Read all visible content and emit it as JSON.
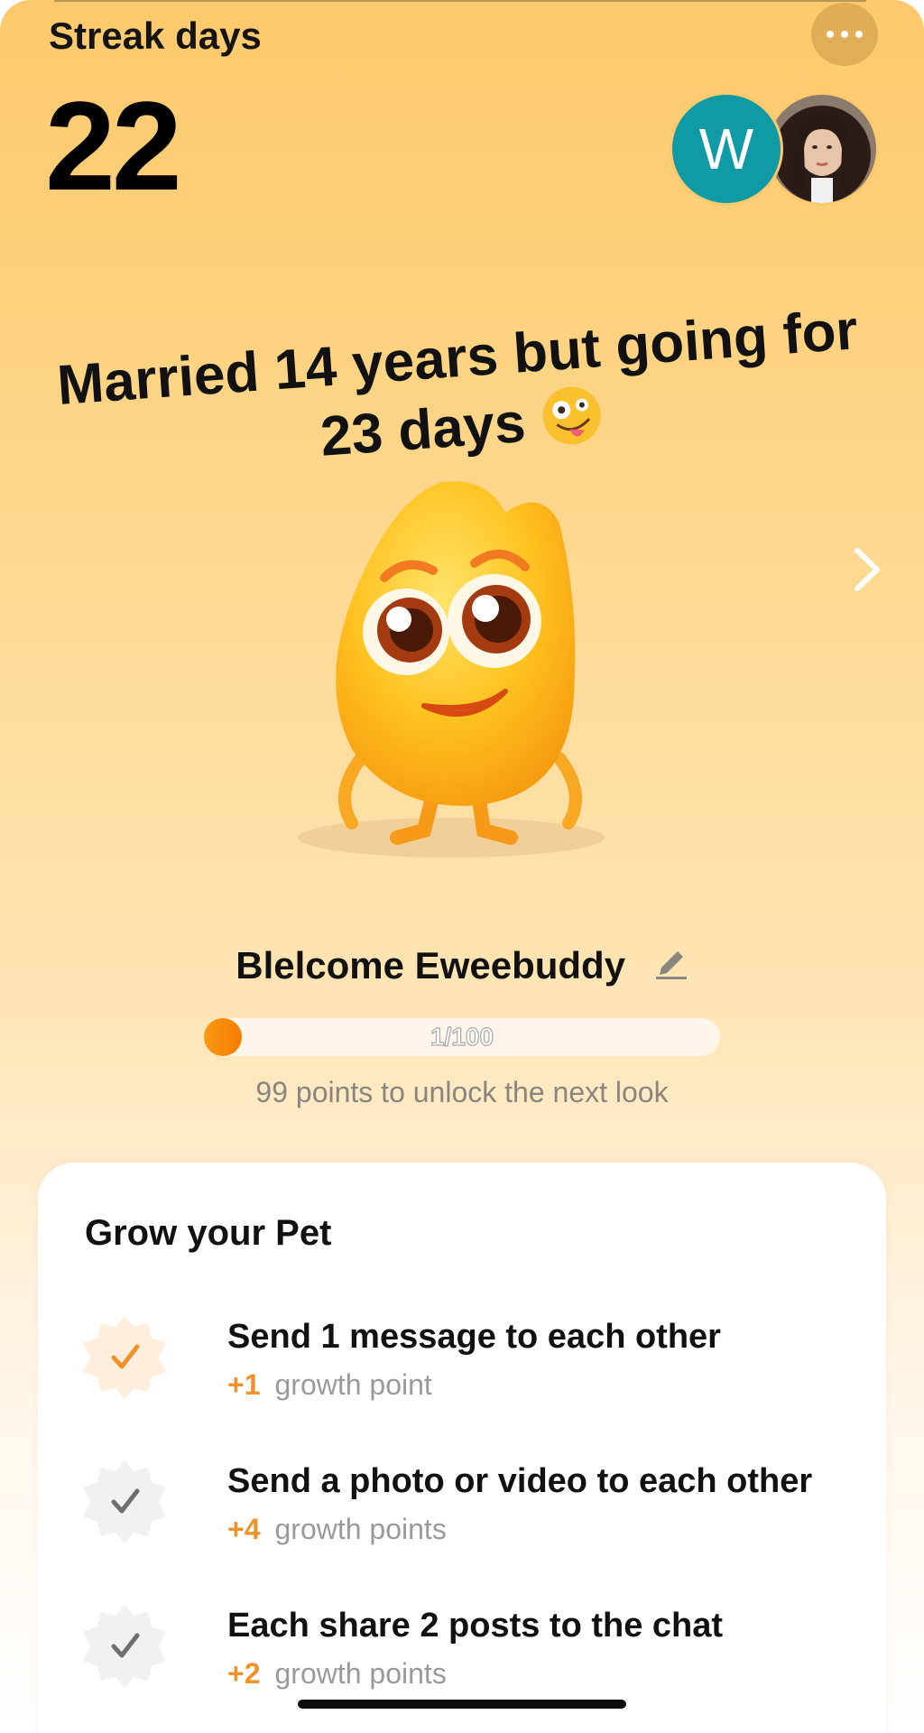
{
  "header": {
    "streak_label": "Streak days",
    "streak_count": "22",
    "more_icon": "more-horizontal-icon",
    "avatar_w_initial": "W"
  },
  "headline": {
    "text": "Married 14 years but going for 23 days",
    "emoji": "🤪"
  },
  "pet": {
    "name": "Blelcome Eweebuddy",
    "progress_current": 1,
    "progress_max": 100,
    "progress_label": "1/100",
    "unlock_hint": "99 points to unlock the next look"
  },
  "grow_card": {
    "title": "Grow your Pet",
    "tasks": [
      {
        "title": "Send 1 message to each other",
        "plus": "+1",
        "unit": "growth point",
        "completed": true
      },
      {
        "title": "Send a photo or video to each other",
        "plus": "+4",
        "unit": "growth points",
        "completed": false
      },
      {
        "title": "Each share 2 posts to the chat",
        "plus": "+2",
        "unit": "growth points",
        "completed": false
      }
    ]
  },
  "colors": {
    "accent_orange": "#f57c00",
    "avatar_teal": "#0f9aa6",
    "points_orange": "#f0922c"
  }
}
